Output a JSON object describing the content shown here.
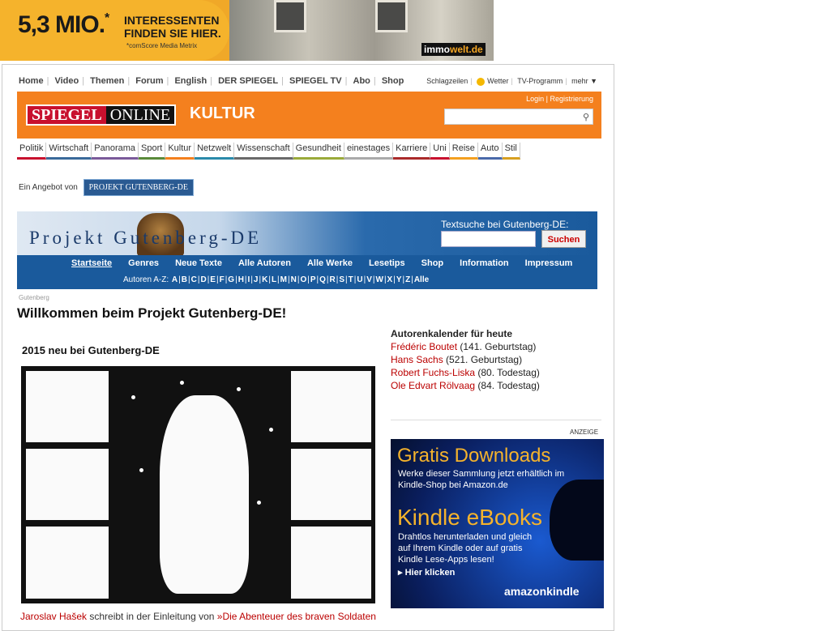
{
  "ad_banner": {
    "headline": "5,3 MIO.",
    "star": "*",
    "text_line1": "INTERESSENTEN",
    "text_line2": "FINDEN SIE HIER.",
    "footnote": "*comScore Media Metrix",
    "logo_prefix": "immo",
    "logo_suffix": "welt.de"
  },
  "topnav": {
    "items": [
      "Home",
      "Video",
      "Themen",
      "Forum",
      "English",
      "DER SPIEGEL",
      "SPIEGEL TV",
      "Abo",
      "Shop"
    ],
    "right": [
      "Schlagzeilen",
      "Wetter",
      "TV-Programm",
      "mehr ▼"
    ]
  },
  "header": {
    "logo_spiegel": "SPIEGEL",
    "logo_online": "ONLINE",
    "section": "KULTUR",
    "login": "Login",
    "register": "Registrierung",
    "search_placeholder": ""
  },
  "sections": [
    "Politik",
    "Wirtschaft",
    "Panorama",
    "Sport",
    "Kultur",
    "Netzwelt",
    "Wissenschaft",
    "Gesundheit",
    "einestages",
    "Karriere",
    "Uni",
    "Reise",
    "Auto",
    "Stil"
  ],
  "offer": {
    "label": "Ein Angebot von",
    "partner": "PROJEKT GUTENBERG-DE"
  },
  "gutenberg": {
    "title": "Projekt Gutenberg-DE",
    "search_label": "Textsuche bei Gutenberg-DE:",
    "search_button": "Suchen",
    "menu": [
      "Startseite",
      "Genres",
      "Neue Texte",
      "Alle Autoren",
      "Alle Werke",
      "Lesetips",
      "Shop",
      "Information",
      "Impressum"
    ],
    "az_label": "Autoren A-Z:",
    "letters": [
      "A",
      "B",
      "C",
      "D",
      "E",
      "F",
      "G",
      "H",
      "I",
      "J",
      "K",
      "L",
      "M",
      "N",
      "O",
      "P",
      "Q",
      "R",
      "S",
      "T",
      "U",
      "V",
      "W",
      "X",
      "Y",
      "Z",
      "Alle"
    ]
  },
  "breadcrumb": "Gutenberg",
  "page_title": "Willkommen beim Projekt Gutenberg-DE!",
  "new_heading": "2015 neu bei Gutenberg-DE",
  "caption": {
    "author": "Jaroslav Hašek",
    "text": " schreibt in der Einleitung von ",
    "work": "»Die Abenteuer des braven Soldaten"
  },
  "calendar": {
    "title": "Autorenkalender für heute",
    "entries": [
      {
        "name": "Frédéric Boutet",
        "note": " (141. Geburtstag)"
      },
      {
        "name": "Hans Sachs",
        "note": " (521. Geburtstag)"
      },
      {
        "name": "Robert Fuchs-Liska",
        "note": " (80. Todestag)"
      },
      {
        "name": "Ole Edvart Rölvaag",
        "note": " (84. Todestag)"
      }
    ]
  },
  "kindle_ad": {
    "label": "ANZEIGE",
    "headline1": "Gratis Downloads",
    "desc1_l1": "Werke dieser Sammlung jetzt erhältlich im",
    "desc1_l2": "Kindle-Shop bei Amazon.de",
    "headline2": "Kindle eBooks",
    "desc2_l1": "Drahtlos herunterladen und gleich",
    "desc2_l2": "auf Ihrem Kindle oder auf gratis",
    "desc2_l3": "Kindle Lese-Apps lesen!",
    "cta": "Hier klicken",
    "brand": "amazonkindle"
  }
}
